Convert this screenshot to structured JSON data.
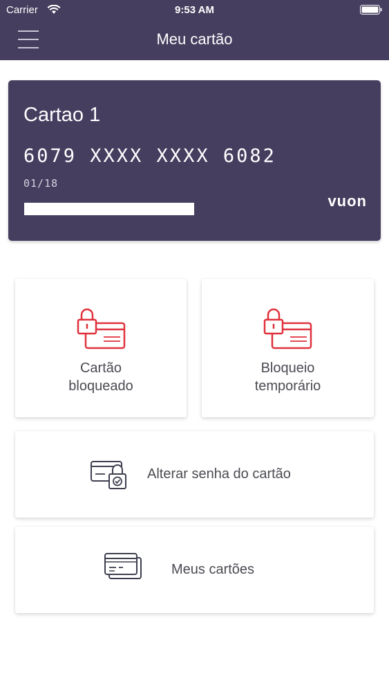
{
  "status_bar": {
    "carrier": "Carrier",
    "time": "9:53 AM",
    "icons": [
      "wifi-icon",
      "battery-icon"
    ]
  },
  "header": {
    "title": "Meu cartão",
    "menu_icon": "hamburger-menu-icon"
  },
  "card": {
    "name": "Cartao 1",
    "number": "6079 XXXX XXXX 6082",
    "expiry": "01/18",
    "brand": "vuon"
  },
  "tiles": {
    "blocked": {
      "label_line1": "Cartão",
      "label_line2": "bloqueado",
      "icon": "locked-card-icon"
    },
    "temporary": {
      "label_line1": "Bloqueio",
      "label_line2": "temporário",
      "icon": "locked-card-icon"
    }
  },
  "rows": {
    "change_password": {
      "label": "Alterar senha do cartão",
      "icon": "card-password-icon"
    },
    "my_cards": {
      "label": "Meus cartões",
      "icon": "cards-stack-icon"
    }
  },
  "colors": {
    "header_bg": "#453e5f",
    "card_bg": "#453e5f",
    "accent_red": "#e0313c",
    "icon_dark": "#3e3f4f",
    "text": "#4a4a52"
  }
}
